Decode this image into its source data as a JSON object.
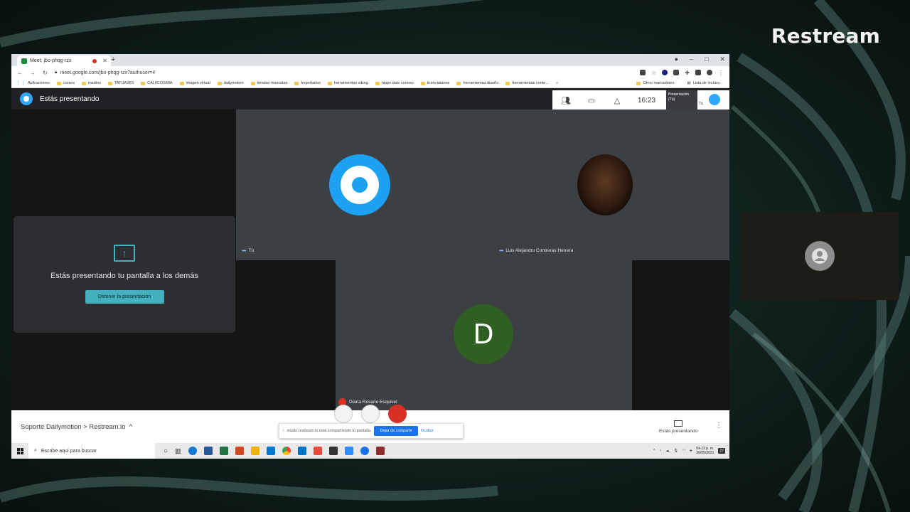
{
  "brand": "Restream",
  "browser": {
    "tab_title": "Meet: jbo-phqg-rzx",
    "new_tab": "+",
    "url": "meet.google.com/jbo-phqg-rzx?authuser=4",
    "bookmarks": [
      "Aplicaciones",
      "cursos",
      "medios",
      "TATUAJES",
      "CALIICOSMIA",
      "imagen virtual",
      "dailymotion",
      "tiendas mascotas",
      "Importados",
      "herramientas viking",
      "hippo dato curioso",
      "licenciatarios",
      "herramientas diseño",
      "herramientas conte..."
    ],
    "bookmarks_more": "»",
    "other_bookmarks": "Otros marcadores",
    "reading_list": "Lista de lectura"
  },
  "meet": {
    "presenting_label": "Estás presentando",
    "time": "16:23",
    "pres_thumb_title": "Presentación",
    "pres_thumb_sub": "(Tú)",
    "me_label": "Tú",
    "present_card_text": "Estás presentando tu pantalla a los demás",
    "stop_button": "Detener la presentación",
    "participants": [
      {
        "name": "Tú"
      },
      {
        "name": "Luis Alejandro Contreras Herrera"
      },
      {
        "name": "Diana Rosario Esquivel",
        "initial": "D"
      }
    ],
    "meeting_title": "Soporte Dailymotion > Restream.io",
    "meeting_chevron": "^",
    "share_notice": "studio.restream.io está compartiendo tu pantalla.",
    "share_stop": "Dejar de compartir",
    "share_hide": "Ocultar",
    "bottom_presenting": "Estás presentando",
    "more": "⋮"
  },
  "taskbar": {
    "search_placeholder": "Escribe aquí para buscar",
    "time": "04:23 p. m.",
    "date": "26/05/2021",
    "notif_count": "27"
  },
  "colors": {
    "teal_accent": "#45b0bd",
    "meet_dark": "#202124",
    "tile": "#3c4043",
    "google_blue": "#1a73e8",
    "dailymotion_blue": "#1da1f2",
    "avatar_green": "#2f5f22",
    "mic_off_red": "#d93025"
  }
}
